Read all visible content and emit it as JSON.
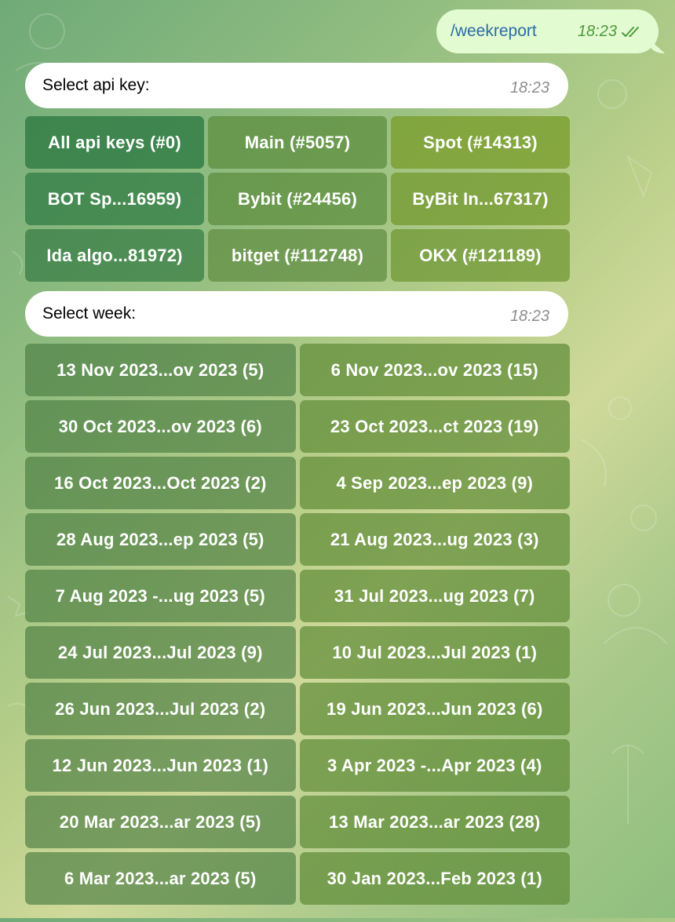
{
  "outgoing": {
    "command": "/weekreport",
    "time": "18:23",
    "status_icon": "double-check-icon"
  },
  "api_prompt": {
    "text": "Select api key:",
    "time": "18:23"
  },
  "api_keys": [
    "All api keys (#0)",
    "Main (#5057)",
    "Spot (#14313)",
    "BOT Sp...16959)",
    "Bybit (#24456)",
    "ByBit In...67317)",
    "Ida algo...81972)",
    "bitget (#112748)",
    "OKX (#121189)"
  ],
  "week_prompt": {
    "text": "Select week:",
    "time": "18:23"
  },
  "weeks": [
    "13 Nov 2023...ov 2023 (5)",
    "6 Nov 2023...ov 2023 (15)",
    "30 Oct 2023...ov 2023 (6)",
    "23 Oct 2023...ct 2023 (19)",
    "16 Oct 2023...Oct 2023 (2)",
    "4 Sep 2023...ep 2023 (9)",
    "28 Aug 2023...ep 2023 (5)",
    "21 Aug 2023...ug 2023 (3)",
    "7 Aug 2023 -...ug 2023 (5)",
    "31 Jul 2023...ug 2023 (7)",
    "24 Jul 2023...Jul 2023 (9)",
    "10 Jul 2023...Jul 2023 (1)",
    "26 Jun 2023...Jul 2023 (2)",
    "19 Jun 2023...Jun 2023 (6)",
    "12 Jun 2023...Jun 2023 (1)",
    "3 Apr 2023 -...Apr 2023 (4)",
    "20 Mar 2023...ar 2023 (5)",
    "13 Mar 2023...ar 2023 (28)",
    "6 Mar 2023...ar 2023 (5)",
    "30 Jan 2023...Feb 2023 (1)"
  ],
  "colors": {
    "outgoing_bubble": "#e3fbd0",
    "link": "#2a6ca8",
    "outgoing_meta": "#4c9a3e",
    "incoming_bubble": "#ffffff",
    "time_gray": "#8e8e8e"
  }
}
